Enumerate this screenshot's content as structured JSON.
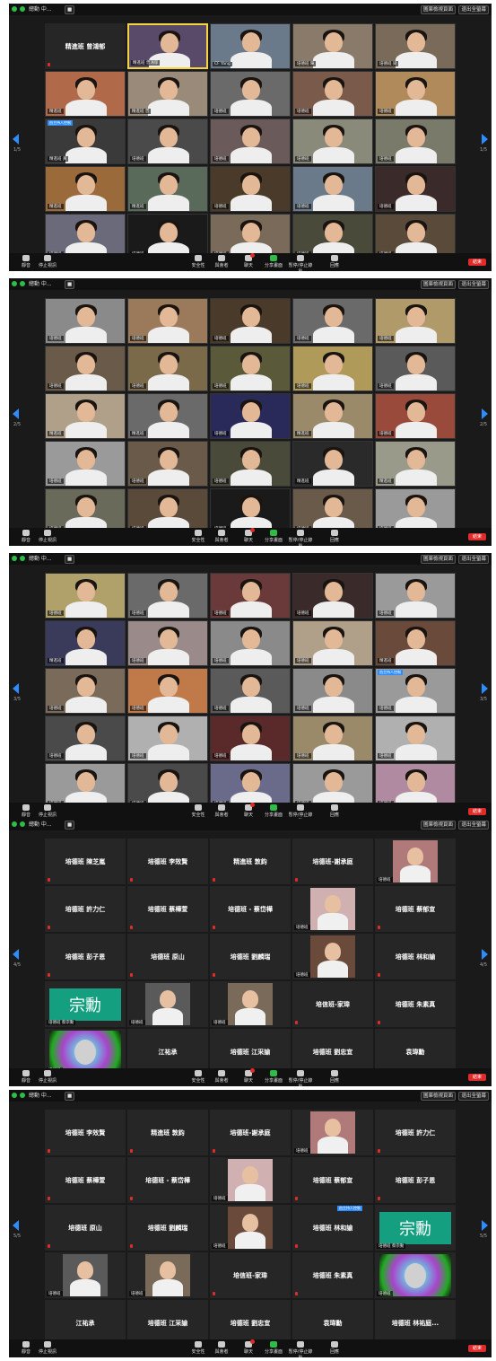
{
  "toolbar": {
    "title": "總動 中...",
    "view_label": "■",
    "gallery_label": "圖庫檢視頁面",
    "fullscreen_label": "退出全螢幕",
    "items": [
      {
        "label": "靜音"
      },
      {
        "label": "停止視訊"
      },
      {
        "label": "安全性"
      },
      {
        "label": "與會者"
      },
      {
        "label": "聊天"
      },
      {
        "label": "分享畫面"
      },
      {
        "label": "暫停/停止錄製"
      },
      {
        "label": "回應"
      }
    ],
    "end_label": "結束"
  },
  "pages": [
    {
      "page_label": "1/5",
      "tiles": [
        {
          "type": "name",
          "name": "精進班 曾鴻郁"
        },
        {
          "type": "video",
          "label": "精進班 曾鴻郁",
          "active": true,
          "tone": "#5a4a6a"
        },
        {
          "type": "video",
          "label": "CF Yang",
          "tone": "#6a7a8a"
        },
        {
          "type": "video",
          "label": "培德班 陳",
          "tone": "#8a7a6a"
        },
        {
          "type": "video",
          "label": "培德班 梁",
          "tone": "#7a6a5a"
        },
        {
          "type": "video",
          "label": "精進班",
          "tone": "#b06a4a"
        },
        {
          "type": "video",
          "label": "精進班 曾",
          "tone": "#9a8a7a"
        },
        {
          "type": "video",
          "label": "培德班",
          "tone": "#6a6a6a"
        },
        {
          "type": "video",
          "label": "培德班",
          "tone": "#7a5a4a"
        },
        {
          "type": "video",
          "label": "培德班",
          "tone": "#b08a5a"
        },
        {
          "type": "video",
          "label": "精進班 黃",
          "tone": "#3a3a3a",
          "spot": "由主持人控制"
        },
        {
          "type": "video",
          "label": "培德班",
          "tone": "#4a4a4a"
        },
        {
          "type": "video",
          "label": "培德班",
          "tone": "#6a5a5a"
        },
        {
          "type": "video",
          "label": "培德班",
          "tone": "#8a8a7a"
        },
        {
          "type": "video",
          "label": "培德班",
          "tone": "#7a7a6a"
        },
        {
          "type": "video",
          "label": "精進班",
          "tone": "#9a6a3a"
        },
        {
          "type": "video",
          "label": "精進班",
          "tone": "#5a6a5a"
        },
        {
          "type": "video",
          "label": "培德班",
          "tone": "#4a3a2a"
        },
        {
          "type": "video",
          "label": "培德班",
          "tone": "#6a7a8a"
        },
        {
          "type": "video",
          "label": "培德班",
          "tone": "#3a2a2a"
        },
        {
          "type": "video",
          "label": "培德班",
          "tone": "#6a6a7a"
        },
        {
          "type": "video",
          "label": "培德班",
          "tone": "#1a1a1a"
        },
        {
          "type": "video",
          "label": "培德班",
          "tone": "#7a6a5a"
        },
        {
          "type": "video",
          "label": "培德班",
          "tone": "#4a4a3a"
        },
        {
          "type": "video",
          "label": "培德班",
          "tone": "#5a4a3a"
        }
      ]
    },
    {
      "page_label": "2/5",
      "tiles": [
        {
          "type": "video",
          "label": "培德班",
          "tone": "#8a8a8a"
        },
        {
          "type": "video",
          "label": "培德班",
          "tone": "#9a7a5a"
        },
        {
          "type": "video",
          "label": "培德班",
          "tone": "#4a3a2a"
        },
        {
          "type": "video",
          "label": "培德班",
          "tone": "#6a6a6a"
        },
        {
          "type": "video",
          "label": "培德班",
          "tone": "#b09a6a"
        },
        {
          "type": "video",
          "label": "培德班",
          "tone": "#6a5a4a"
        },
        {
          "type": "video",
          "label": "培德班",
          "tone": "#7a6a4a"
        },
        {
          "type": "video",
          "label": "培德班",
          "tone": "#5a5a3a"
        },
        {
          "type": "video",
          "label": "培德班",
          "tone": "#b09a5a"
        },
        {
          "type": "video",
          "label": "培德班",
          "tone": "#5a5a5a"
        },
        {
          "type": "video",
          "label": "精進班",
          "tone": "#b0a08a"
        },
        {
          "type": "video",
          "label": "精進班",
          "tone": "#6a6a6a"
        },
        {
          "type": "video",
          "label": "培德班",
          "tone": "#2a2a5a"
        },
        {
          "type": "video",
          "label": "精進班",
          "tone": "#9a8a6a"
        },
        {
          "type": "video",
          "label": "培德班",
          "tone": "#9a4a3a"
        },
        {
          "type": "video",
          "label": "培德班",
          "tone": "#9a9a9a"
        },
        {
          "type": "video",
          "label": "培德班",
          "tone": "#6a5a4a"
        },
        {
          "type": "video",
          "label": "培德班",
          "tone": "#4a4a3a"
        },
        {
          "type": "video",
          "label": "精進班",
          "tone": "#2a2a2a"
        },
        {
          "type": "video",
          "label": "精進班",
          "tone": "#9a9a8a"
        },
        {
          "type": "video",
          "label": "培德班",
          "tone": "#6a6a5a"
        },
        {
          "type": "video",
          "label": "培德班",
          "tone": "#5a4a3a"
        },
        {
          "type": "video",
          "label": "培德班",
          "tone": "#1a1a1a"
        },
        {
          "type": "video",
          "label": "培德班",
          "tone": "#6a5a4a"
        },
        {
          "type": "video",
          "label": "培德班",
          "tone": "#9a9a9a"
        }
      ]
    },
    {
      "page_label": "3/5",
      "tiles": [
        {
          "type": "video",
          "label": "培德班",
          "tone": "#b0a06a"
        },
        {
          "type": "video",
          "label": "培德班",
          "tone": "#6a6a6a"
        },
        {
          "type": "video",
          "label": "培德班",
          "tone": "#6a3a3a"
        },
        {
          "type": "video",
          "label": "培德班",
          "tone": "#3a2a2a"
        },
        {
          "type": "video",
          "label": "培德班",
          "tone": "#9a9a9a"
        },
        {
          "type": "video",
          "label": "精進班",
          "tone": "#3a3a5a"
        },
        {
          "type": "video",
          "label": "培德班",
          "tone": "#9a8a8a"
        },
        {
          "type": "video",
          "label": "培德班",
          "tone": "#8a8a8a"
        },
        {
          "type": "video",
          "label": "培德班",
          "tone": "#b0a08a"
        },
        {
          "type": "video",
          "label": "精進班",
          "tone": "#6a4a3a"
        },
        {
          "type": "video",
          "label": "培德班",
          "tone": "#7a6a5a"
        },
        {
          "type": "video",
          "label": "培德班",
          "tone": "#c07a4a"
        },
        {
          "type": "video",
          "label": "培德班",
          "tone": "#5a5a5a"
        },
        {
          "type": "video",
          "label": "培德班",
          "tone": "#8a8a8a"
        },
        {
          "type": "video",
          "label": "培德班",
          "tone": "#9a9a9a",
          "spot": "由主持人控制"
        },
        {
          "type": "video",
          "label": "培德班",
          "tone": "#4a4a4a"
        },
        {
          "type": "video",
          "label": "培德班",
          "tone": "#b0b0b0"
        },
        {
          "type": "video",
          "label": "培德班",
          "tone": "#5a2a2a"
        },
        {
          "type": "video",
          "label": "培德班",
          "tone": "#9a8a6a"
        },
        {
          "type": "video",
          "label": "培德班",
          "tone": "#b0b0b0"
        },
        {
          "type": "video",
          "label": "培德班",
          "tone": "#9a9a9a"
        },
        {
          "type": "video",
          "label": "培德班",
          "tone": "#4a4a4a"
        },
        {
          "type": "video",
          "label": "培德班",
          "tone": "#6a6a8a"
        },
        {
          "type": "video",
          "label": "培德班",
          "tone": "#9a9a9a"
        },
        {
          "type": "video",
          "label": "培德班",
          "tone": "#b08aa0"
        }
      ]
    },
    {
      "page_label": "4/5",
      "tiles": [
        {
          "type": "name",
          "name": "培德班 陳芝嵐"
        },
        {
          "type": "name",
          "name": "培德班 李效賢"
        },
        {
          "type": "name",
          "name": "精進班 敦鈞"
        },
        {
          "type": "name",
          "name": "培德班-謝承庭"
        },
        {
          "type": "mini",
          "label": "培德班",
          "tone": "#b07a7a"
        },
        {
          "type": "name",
          "name": "培德班 許力仁"
        },
        {
          "type": "name",
          "name": "培德班 蔡樺萱"
        },
        {
          "type": "name",
          "name": "培德班 - 蔡岱樺"
        },
        {
          "type": "mini",
          "label": "培德班",
          "tone": "#d0b0b0"
        },
        {
          "type": "name",
          "name": "培德班 蔡郁宣"
        },
        {
          "type": "name",
          "name": "培德班 彭子恩"
        },
        {
          "type": "name",
          "name": "培德班 原山"
        },
        {
          "type": "name",
          "name": "培德班 劉麟瑞"
        },
        {
          "type": "mini",
          "label": "培德班",
          "tone": "#6a4a3a"
        },
        {
          "type": "name",
          "name": "培德班 林和諭"
        },
        {
          "type": "zong",
          "label": "培德班 蔡宗勳",
          "text": "宗勳"
        },
        {
          "type": "mini",
          "label": "培德班",
          "tone": "#5a5a5a"
        },
        {
          "type": "mini",
          "label": "培德班",
          "tone": "#7a6a5a"
        },
        {
          "type": "name",
          "name": "培信班-家瑋"
        },
        {
          "type": "name",
          "name": "培德班 朱素真"
        },
        {
          "type": "cat",
          "label": "培德班"
        },
        {
          "type": "name",
          "name": "江祐承"
        },
        {
          "type": "name",
          "name": "培德班 江采諭"
        },
        {
          "type": "name",
          "name": "培德班 劉忠宜"
        },
        {
          "type": "name",
          "name": "袁瑋勳"
        }
      ]
    },
    {
      "page_label": "5/5",
      "tiles": [
        {
          "type": "name",
          "name": "培德班 李效賢"
        },
        {
          "type": "name",
          "name": "精進班 敦鈞"
        },
        {
          "type": "name",
          "name": "培德班-謝承庭"
        },
        {
          "type": "mini",
          "label": "培德班",
          "tone": "#b07a7a"
        },
        {
          "type": "name",
          "name": "培德班 許力仁"
        },
        {
          "type": "name",
          "name": "培德班 蔡樺萱"
        },
        {
          "type": "name",
          "name": "培德班 - 蔡岱樺"
        },
        {
          "type": "mini",
          "label": "培德班",
          "tone": "#d0b0b0"
        },
        {
          "type": "name",
          "name": "培德班 蔡郁宣"
        },
        {
          "type": "name",
          "name": "培德班 彭子恩"
        },
        {
          "type": "name",
          "name": "培德班 原山"
        },
        {
          "type": "name",
          "name": "培德班 劉麟瑞"
        },
        {
          "type": "mini",
          "label": "培德班",
          "tone": "#6a4a3a"
        },
        {
          "type": "name",
          "name": "培德班 林和諭",
          "spot": "由主持人控制"
        },
        {
          "type": "zong",
          "label": "培德班 蔡宗勳",
          "text": "宗勳"
        },
        {
          "type": "mini",
          "label": "培德班",
          "tone": "#5a5a5a"
        },
        {
          "type": "mini",
          "label": "培德班",
          "tone": "#7a6a5a"
        },
        {
          "type": "name",
          "name": "培信班-家瑋"
        },
        {
          "type": "name",
          "name": "培德班 朱素真"
        },
        {
          "type": "cat",
          "label": "培德班"
        },
        {
          "type": "name",
          "name": "江祐承"
        },
        {
          "type": "name",
          "name": "培德班 江采諭"
        },
        {
          "type": "name",
          "name": "培德班 劉忠宜"
        },
        {
          "type": "name",
          "name": "袁瑋勳"
        },
        {
          "type": "name",
          "name": "培德班 林祐庭..."
        }
      ]
    }
  ],
  "colors": {
    "accent": "#2d8cff",
    "recording": "#2dbe48",
    "end": "#e02b2b",
    "active_speaker": "#f5d442",
    "zong_bg": "#139f80"
  }
}
